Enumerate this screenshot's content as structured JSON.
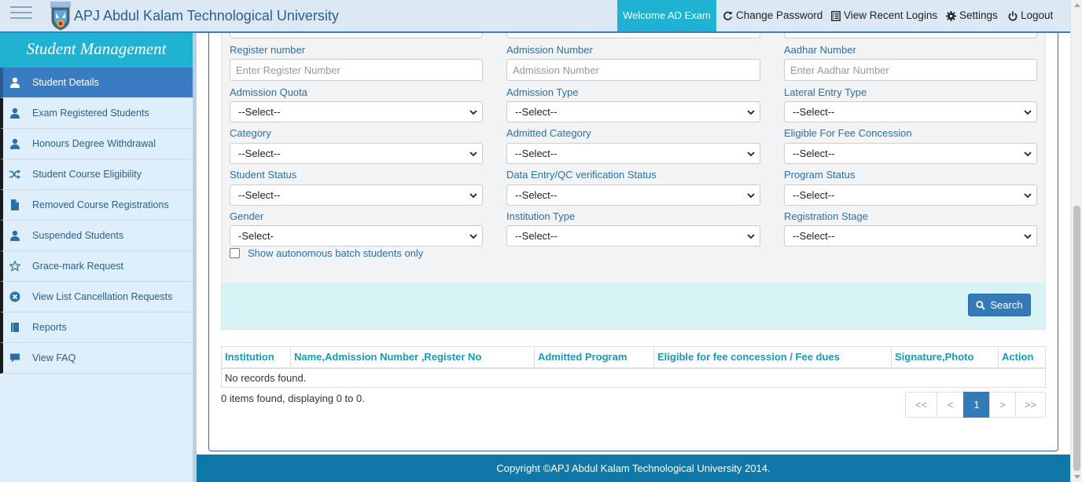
{
  "header": {
    "app_title": "APJ Abdul Kalam Technological University",
    "welcome": "Welcome AD Exam",
    "change_password": "Change Password",
    "recent_logins": "View Recent Logins",
    "settings": "Settings",
    "logout": "Logout",
    "accent_color": "#1fb2d3"
  },
  "sidebar": {
    "title": "Student Management",
    "items": [
      {
        "label": "Student Details",
        "icon": "user-icon",
        "active": true
      },
      {
        "label": "Exam Registered Students",
        "icon": "user-icon"
      },
      {
        "label": "Honours Degree Withdrawal",
        "icon": "user-icon"
      },
      {
        "label": "Student Course Eligibility",
        "icon": "shuffle-icon"
      },
      {
        "label": "Removed Course Registrations",
        "icon": "file-icon"
      },
      {
        "label": "Suspended Students",
        "icon": "user-icon"
      },
      {
        "label": "Grace-mark Request",
        "icon": "star-icon"
      },
      {
        "label": "View List Cancellation Requests",
        "icon": "remove-circle-icon"
      },
      {
        "label": "Reports",
        "icon": "book-icon"
      },
      {
        "label": "View FAQ",
        "icon": "comment-icon"
      }
    ]
  },
  "form": {
    "register_number": {
      "label": "Register number",
      "placeholder": "Enter Register Number"
    },
    "admission_number": {
      "label": "Admission Number",
      "placeholder": "Admission Number"
    },
    "aadhar_number": {
      "label": "Aadhar Number",
      "placeholder": "Enter Aadhar Number"
    },
    "admission_quota": {
      "label": "Admission Quota",
      "value": "--Select--"
    },
    "admission_type": {
      "label": "Admission Type",
      "value": "--Select--"
    },
    "lateral_entry_type": {
      "label": "Lateral Entry Type",
      "value": "--Select--"
    },
    "category": {
      "label": "Category",
      "value": "--Select--"
    },
    "admitted_category": {
      "label": "Admitted Category",
      "value": "--Select--"
    },
    "fee_concession": {
      "label": "Eligible For Fee Concession",
      "value": "--Select--"
    },
    "student_status": {
      "label": "Student Status",
      "value": "--Select--"
    },
    "qc_status": {
      "label": "Data Entry/QC verification Status",
      "value": "--Select--"
    },
    "program_status": {
      "label": "Program Status",
      "value": "--Select--"
    },
    "gender": {
      "label": "Gender",
      "value": "-Select-"
    },
    "institution_type": {
      "label": "Institution Type",
      "value": "--Select--"
    },
    "registration_stage": {
      "label": "Registration Stage",
      "value": "--Select--"
    },
    "autonomous_label": "Show autonomous batch students only",
    "autonomous_checked": false,
    "search_label": "Search"
  },
  "table": {
    "columns": [
      "Institution",
      "Name,Admission Number ,Register No",
      "Admitted Program",
      "Eligible for fee concession / Fee dues",
      "Signature,Photo",
      "Action"
    ],
    "empty_message": "No records found.",
    "summary": "0 items found, displaying 0 to 0."
  },
  "pagination": {
    "first": "<<",
    "prev": "<",
    "current": "1",
    "next": ">",
    "last": ">>"
  },
  "footer": {
    "copyright": "Copyright ©APJ Abdul Kalam Technological University 2014."
  }
}
